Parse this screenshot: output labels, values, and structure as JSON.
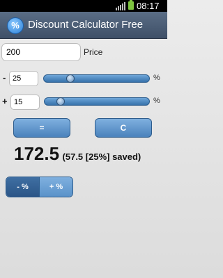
{
  "status_bar": {
    "time": "08:17",
    "icons": [
      "signal-icon",
      "battery-icon"
    ]
  },
  "app": {
    "title": "Discount Calculator Free",
    "icon_glyph": "%"
  },
  "price": {
    "value": "200",
    "label": "Price"
  },
  "discount": {
    "sign": "-",
    "value": "25",
    "unit": "%",
    "slider_level": 0.25
  },
  "surcharge": {
    "sign": "+",
    "value": "15",
    "unit": "%",
    "slider_level": 0.15
  },
  "buttons": {
    "equals": "=",
    "clear": "C"
  },
  "result": {
    "value": "172.5",
    "detail": "(57.5 [25%] saved)"
  },
  "toggle": {
    "minus": "- %",
    "plus": "+ %",
    "selected": "minus"
  },
  "colors": {
    "action_bar": "#4a5c75",
    "button": "#5d94cc",
    "slider": "#4a85bf",
    "battery": "#7ec440"
  }
}
